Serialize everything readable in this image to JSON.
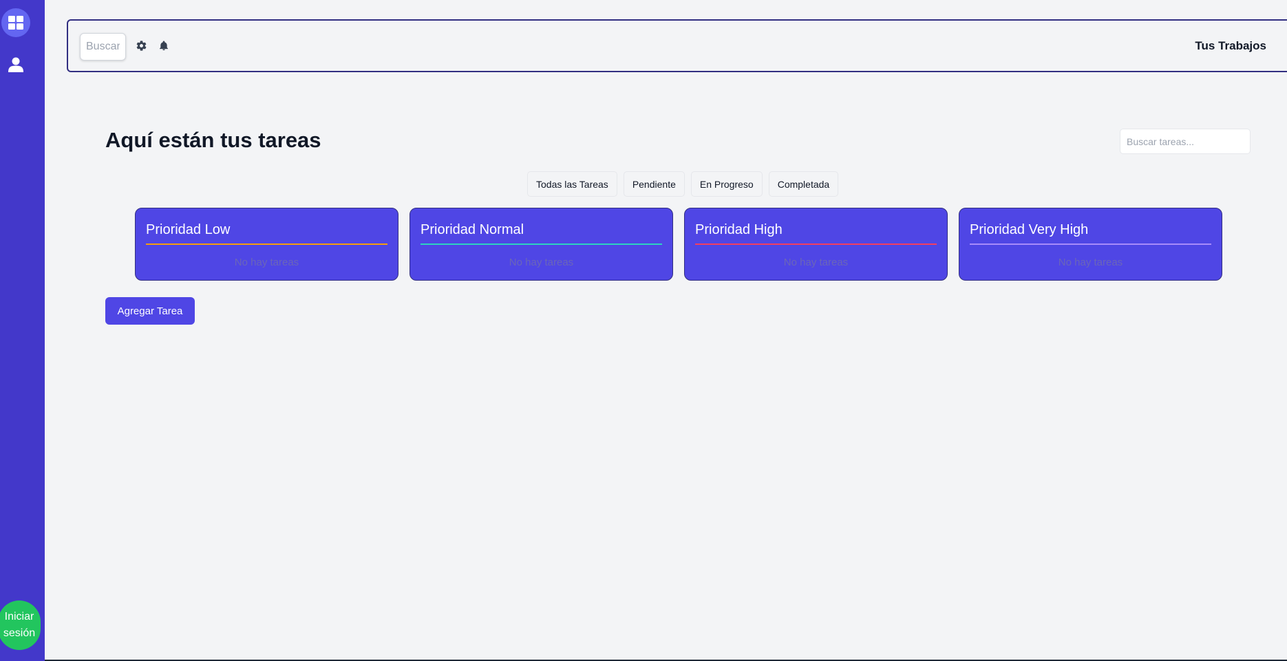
{
  "sidebar": {
    "items": [
      {
        "icon": "dashboard-icon",
        "active": true
      },
      {
        "icon": "user-icon",
        "active": false
      }
    ],
    "login_label": "Iniciar sesión"
  },
  "topbar": {
    "search_placeholder": "Buscar...",
    "title": "Tus Trabajos"
  },
  "main": {
    "title": "Aquí están tus tareas",
    "search_placeholder": "Buscar tareas...",
    "filters": [
      "Todas las Tareas",
      "Pendiente",
      "En Progreso",
      "Completada"
    ],
    "columns": [
      {
        "title": "Prioridad Low",
        "accent": "#f59e0b",
        "empty": "No hay tareas"
      },
      {
        "title": "Prioridad Normal",
        "accent": "#2dd4bf",
        "empty": "No hay tareas"
      },
      {
        "title": "Prioridad High",
        "accent": "#f43f5e",
        "empty": "No hay tareas"
      },
      {
        "title": "Prioridad Very High",
        "accent": "#a78bfa",
        "empty": "No hay tareas"
      }
    ],
    "add_label": "Agregar Tarea"
  },
  "colors": {
    "sidebar": "#4338ca",
    "card": "#4f46e5",
    "login": "#22c55e",
    "background": "#f3f4f6"
  }
}
